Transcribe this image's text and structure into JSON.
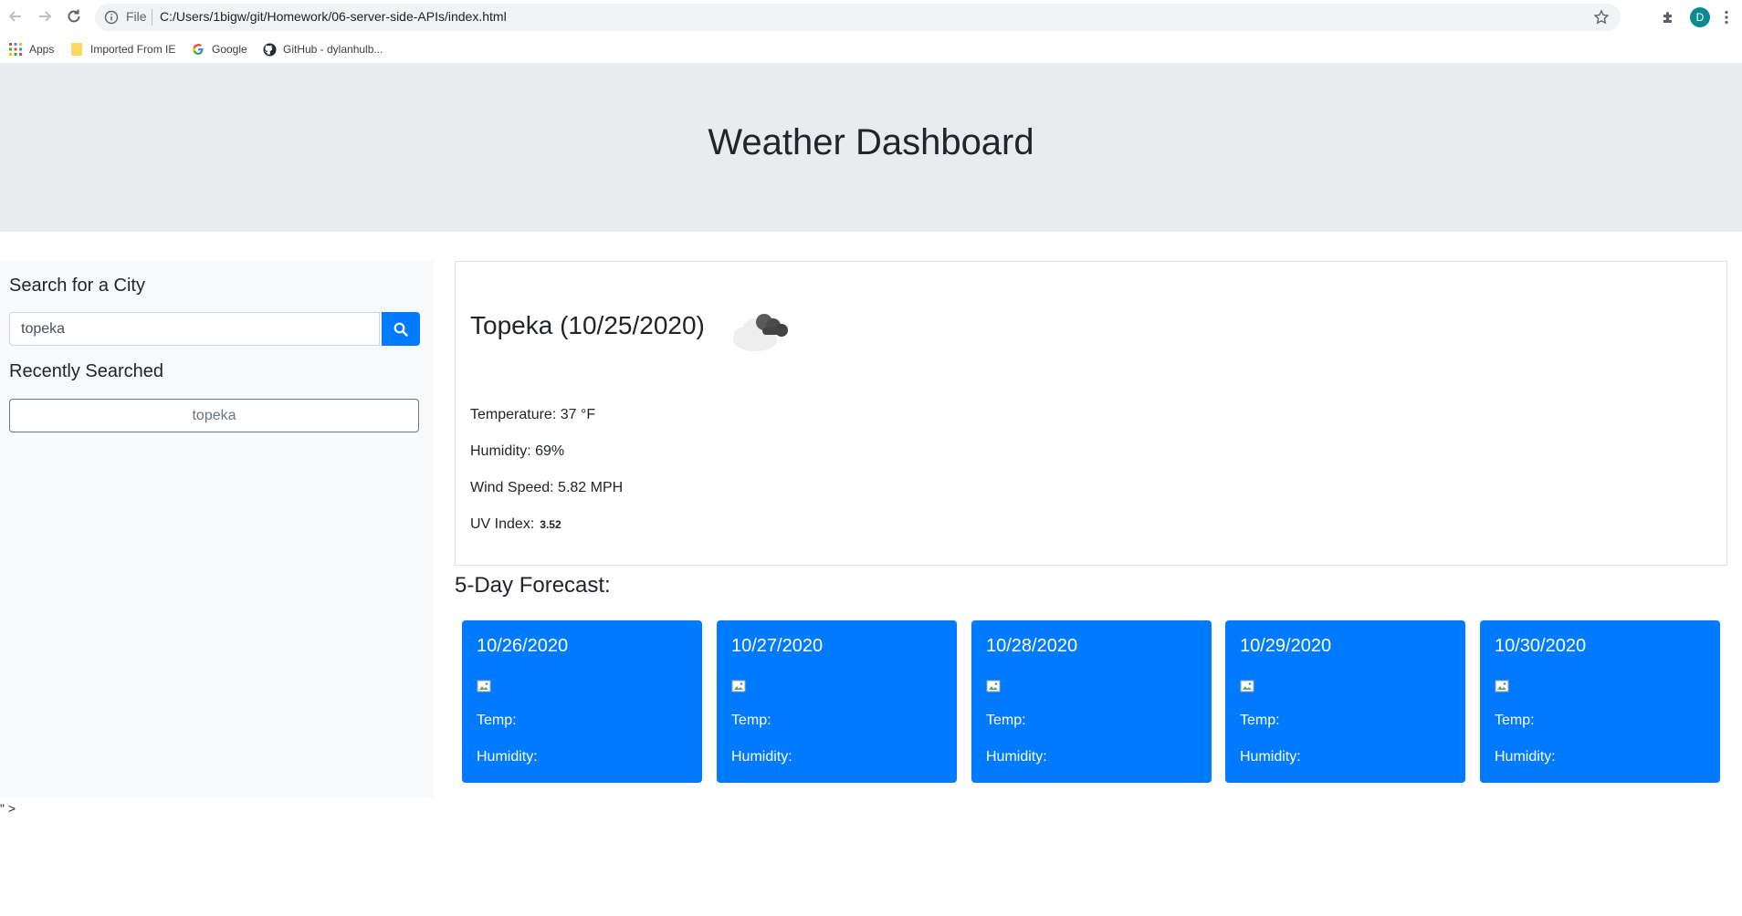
{
  "browser": {
    "file_label": "File",
    "url": "C:/Users/1bigw/git/Homework/06-server-side-APIs/index.html",
    "profile_initial": "D",
    "bookmarks": [
      "Apps",
      "Imported From IE",
      "Google",
      "GitHub - dylanhulb..."
    ]
  },
  "page": {
    "title": "Weather Dashboard",
    "stray_text": "\" >"
  },
  "sidebar": {
    "search_heading": "Search for a City",
    "search_value": "topeka",
    "recent_heading": "Recently Searched",
    "recent_items": [
      "topeka"
    ]
  },
  "current": {
    "city_title": "Topeka (10/25/2020)",
    "icon": "cloud-icon",
    "temperature": "Temperature: 37 °F",
    "humidity": "Humidity: 69%",
    "wind": "Wind Speed: 5.82 MPH",
    "uv_label": "UV Index:",
    "uv_value": "3.52"
  },
  "forecast": {
    "heading": "5-Day Forecast:",
    "days": [
      {
        "date": "10/26/2020",
        "temp": "Temp:",
        "humidity": "Humidity:"
      },
      {
        "date": "10/27/2020",
        "temp": "Temp:",
        "humidity": "Humidity:"
      },
      {
        "date": "10/28/2020",
        "temp": "Temp:",
        "humidity": "Humidity:"
      },
      {
        "date": "10/29/2020",
        "temp": "Temp:",
        "humidity": "Humidity:"
      },
      {
        "date": "10/30/2020",
        "temp": "Temp:",
        "humidity": "Humidity:"
      }
    ]
  },
  "colors": {
    "primary": "#007bff",
    "jumbotron": "#e9ecef",
    "sidebar": "#f8f9fa"
  }
}
